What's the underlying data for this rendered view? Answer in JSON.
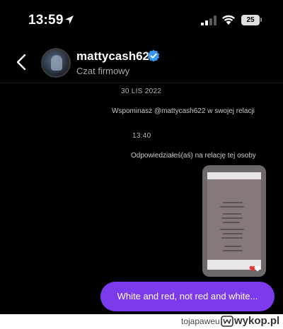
{
  "status_bar": {
    "time": "13:59",
    "battery": "25",
    "icons": [
      "location-icon",
      "signal-icon",
      "wifi-icon",
      "battery-icon"
    ]
  },
  "header": {
    "name": "mattycash622",
    "subtitle": "Czat firmowy",
    "verified": true,
    "icons": [
      "back-icon",
      "verified-icon"
    ]
  },
  "messages": {
    "date": "30 LIS 2022",
    "mention_note": "Wspominasz @mattycash622 w swojej relacji",
    "time2": "13:40",
    "reply_note": "Odpowiedziałeś(aś) na relację tej osoby",
    "bubble_text": "White and red, not red and white..."
  },
  "colors": {
    "bubble": "#7c3aed",
    "verified": "#3797f0",
    "background": "#000000"
  },
  "footer": {
    "user": "tojapaweu",
    "brand": "wykop.pl"
  }
}
